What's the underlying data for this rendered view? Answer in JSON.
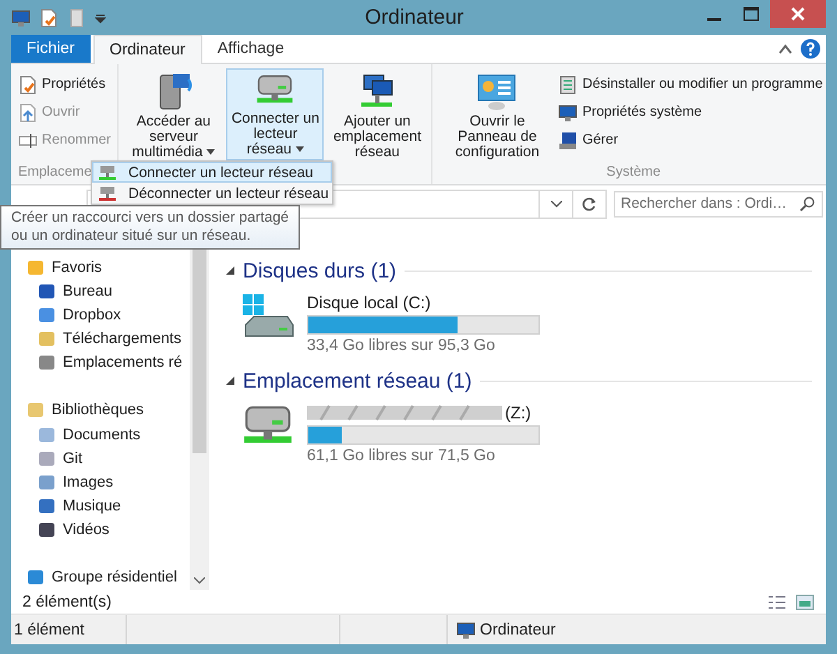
{
  "window": {
    "title": "Ordinateur"
  },
  "tabs": [
    {
      "label": "Fichier",
      "kind": "file",
      "selected": false
    },
    {
      "label": "Ordinateur",
      "kind": "tab",
      "selected": true
    },
    {
      "label": "Affichage",
      "kind": "tab",
      "selected": false
    }
  ],
  "ribbon": {
    "groups": [
      {
        "label": "Emplaceme",
        "items": [
          {
            "kind": "small",
            "label": "Propriétés",
            "disabled": false
          },
          {
            "kind": "small",
            "label": "Ouvrir",
            "disabled": true
          },
          {
            "kind": "small",
            "label": "Renommer",
            "disabled": true
          }
        ]
      },
      {
        "items": [
          {
            "kind": "large",
            "label": "Accéder au serveur multimédia",
            "has_menu": true,
            "pressed": false
          },
          {
            "kind": "large",
            "label": "Connecter un lecteur réseau",
            "has_menu": true,
            "pressed": true
          },
          {
            "kind": "large",
            "label": "Ajouter un emplacement réseau",
            "has_menu": false,
            "pressed": false
          }
        ]
      },
      {
        "label": "Système",
        "items": [
          {
            "kind": "large",
            "label": "Ouvrir le Panneau de configuration",
            "has_menu": false,
            "pressed": false
          },
          {
            "kind": "small",
            "label": "Désinstaller ou modifier un programme",
            "disabled": false
          },
          {
            "kind": "small",
            "label": "Propriétés système",
            "disabled": false
          },
          {
            "kind": "small",
            "label": "Gérer",
            "disabled": false
          }
        ]
      }
    ]
  },
  "menu": {
    "items": [
      {
        "label": "Connecter un lecteur réseau",
        "selected": true
      },
      {
        "label": "Déconnecter un lecteur réseau",
        "selected": false
      }
    ]
  },
  "tooltip": {
    "lines": [
      "Créer un raccourci vers un dossier partagé",
      "ou un ordinateur situé sur un réseau."
    ]
  },
  "search": {
    "placeholder": "Rechercher dans : Ordi…"
  },
  "sidebar": {
    "groups": [
      {
        "label": "Favoris",
        "children": [
          {
            "label": "Bureau"
          },
          {
            "label": "Dropbox"
          },
          {
            "label": "Téléchargements"
          },
          {
            "label": "Emplacements ré"
          }
        ]
      },
      {
        "label": "Bibliothèques",
        "children": [
          {
            "label": "Documents"
          },
          {
            "label": "Git"
          },
          {
            "label": "Images"
          },
          {
            "label": "Musique"
          },
          {
            "label": "Vidéos"
          }
        ]
      },
      {
        "label": "Groupe résidentiel"
      }
    ]
  },
  "sections": [
    {
      "title": "Disques durs (1)",
      "expanded": true,
      "drives": [
        {
          "kind": "local",
          "name": "Disque local (C:)",
          "redacted": false,
          "level": 0.65,
          "reading": "33,4 Go libres sur 95,3 Go"
        }
      ]
    },
    {
      "title": "Emplacement réseau (1)",
      "expanded": true,
      "drives": [
        {
          "kind": "network",
          "name": "(Z:)",
          "redacted": true,
          "level": 0.145,
          "reading": "61,1 Go libres sur 71,5 Go"
        }
      ]
    }
  ],
  "item_count": "2 élément(s)",
  "status_bar": {
    "selection": "1 élément",
    "location": "Ordinateur"
  }
}
